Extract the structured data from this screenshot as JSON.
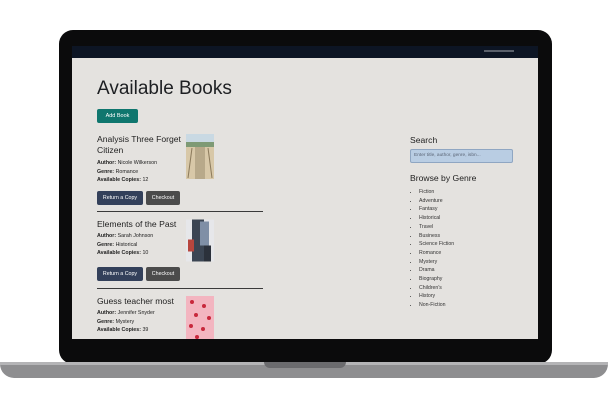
{
  "page": {
    "title": "Available Books",
    "add_button": "Add Book"
  },
  "labels": {
    "author": "Author:",
    "genre": "Genre:",
    "copies": "Available Copies:",
    "return_button": "Return a Copy",
    "checkout_button": "Checkout"
  },
  "books": [
    {
      "title": "Analysis Three Forget Citizen",
      "author": "Nicole Wilkerson",
      "genre": "Romance",
      "copies": "12"
    },
    {
      "title": "Elements of the Past",
      "author": "Sarah Johnson",
      "genre": "Historical",
      "copies": "10"
    },
    {
      "title": "Guess teacher most",
      "author": "Jennifer Snyder",
      "genre": "Mystery",
      "copies": "39"
    }
  ],
  "sidebar": {
    "search_heading": "Search",
    "search_placeholder": "Enter title, author, genre, isbn...",
    "genre_heading": "Browse by Genre",
    "genres": [
      "Fiction",
      "Adventure",
      "Fantasy",
      "Historical",
      "Travel",
      "Business",
      "Science Fiction",
      "Romance",
      "Mystery",
      "Drama",
      "Biography",
      "Children's",
      "History",
      "Non-Fiction"
    ]
  },
  "colors": {
    "accent": "#0f766e",
    "return_btn": "#33405a",
    "checkout_btn": "#4b4b4b",
    "navbar": "#0d1524",
    "page_bg": "#e4e2df"
  }
}
